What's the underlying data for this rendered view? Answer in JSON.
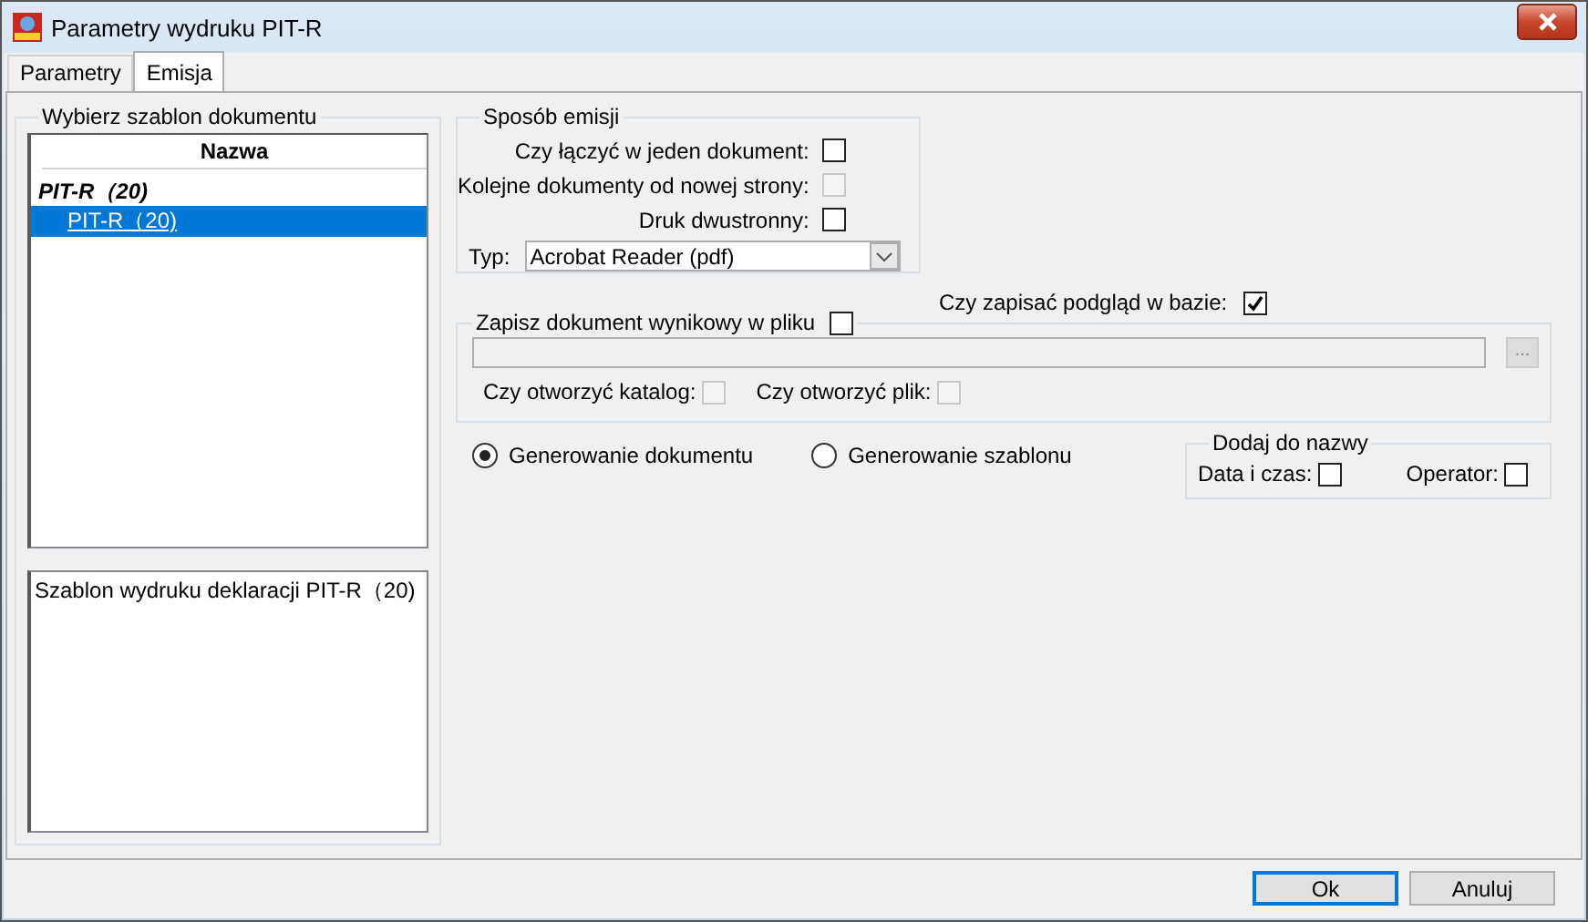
{
  "window": {
    "title": "Parametry wydruku PIT-R"
  },
  "tabs": [
    {
      "label": "Parametry",
      "selected": false
    },
    {
      "label": "Emisja",
      "selected": true
    }
  ],
  "template_panel": {
    "title": "Wybierz szablon dokumentu",
    "column": "Nazwa",
    "groups": [
      {
        "label": "PIT-R（20)",
        "children": [
          {
            "label": "PIT-R（20)",
            "selected": true
          }
        ]
      }
    ],
    "description": "Szablon wydruku deklaracji PIT-R（20)"
  },
  "emission": {
    "title": "Sposób emisji",
    "options": [
      {
        "label": "Czy łączyć w jeden dokument:",
        "checked": false,
        "disabled": false
      },
      {
        "label": "Kolejne dokumenty od nowej strony:",
        "checked": false,
        "disabled": true
      },
      {
        "label": "Druk dwustronny:",
        "checked": false,
        "disabled": false
      }
    ],
    "type_label": "Typ:",
    "type_value": "Acrobat Reader (pdf)"
  },
  "save_preview": {
    "label": "Czy zapisać podgląd w bazie:",
    "checked": true
  },
  "save_file": {
    "label": "Zapisz dokument wynikowy w pliku",
    "checked": false,
    "browse_button": "...",
    "options": [
      {
        "label": "Czy otworzyć katalog:",
        "checked": false,
        "disabled": true
      },
      {
        "label": "Czy otworzyć plik:",
        "checked": false,
        "disabled": true
      }
    ]
  },
  "generation": [
    {
      "label": "Generowanie dokumentu",
      "selected": true
    },
    {
      "label": "Generowanie szablonu",
      "selected": false
    }
  ],
  "add_to_name": {
    "title": "Dodaj do nazwy",
    "options": [
      {
        "label": "Data i czas:",
        "checked": false
      },
      {
        "label": "Operator:",
        "checked": false
      }
    ]
  },
  "buttons": [
    {
      "label": "Ok",
      "default": true
    },
    {
      "label": "Anuluj",
      "default": false
    }
  ]
}
